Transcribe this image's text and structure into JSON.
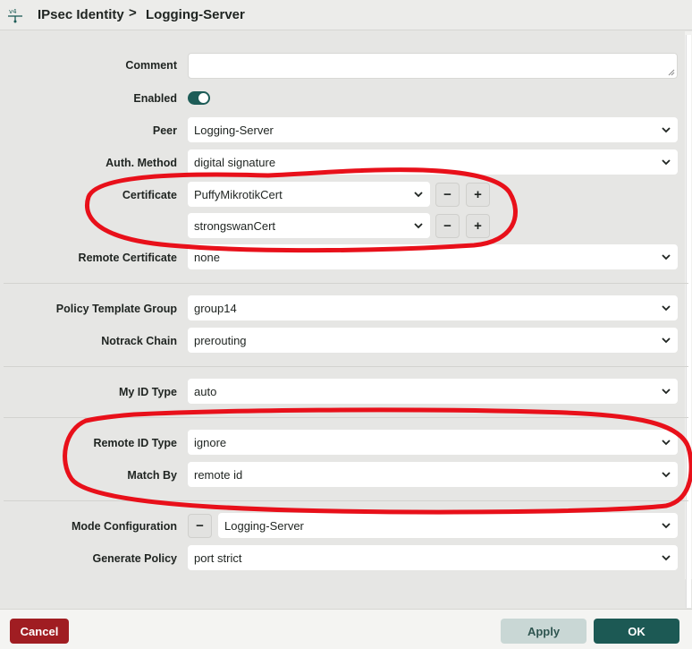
{
  "breadcrumb": {
    "parent": "IPsec Identity",
    "separator": ">",
    "current": "Logging-Server"
  },
  "form": {
    "comment": {
      "label": "Comment",
      "value": ""
    },
    "enabled": {
      "label": "Enabled",
      "value": true
    },
    "peer": {
      "label": "Peer",
      "value": "Logging-Server"
    },
    "auth_method": {
      "label": "Auth. Method",
      "value": "digital signature"
    },
    "certificate": {
      "label": "Certificate",
      "values": [
        "PuffyMikrotikCert",
        "strongswanCert"
      ]
    },
    "remote_certificate": {
      "label": "Remote Certificate",
      "value": "none"
    },
    "policy_template_group": {
      "label": "Policy Template Group",
      "value": "group14"
    },
    "notrack_chain": {
      "label": "Notrack Chain",
      "value": "prerouting"
    },
    "my_id_type": {
      "label": "My ID Type",
      "value": "auto"
    },
    "remote_id_type": {
      "label": "Remote ID Type",
      "value": "ignore"
    },
    "match_by": {
      "label": "Match By",
      "value": "remote id"
    },
    "mode_configuration": {
      "label": "Mode Configuration",
      "value": "Logging-Server"
    },
    "generate_policy": {
      "label": "Generate Policy",
      "value": "port strict"
    }
  },
  "buttons": {
    "minus": "−",
    "plus": "+",
    "cancel": "Cancel",
    "apply": "Apply",
    "ok": "OK"
  },
  "colors": {
    "accent": "#1c5954",
    "danger": "#a01d22",
    "annotation": "#e8101a"
  }
}
